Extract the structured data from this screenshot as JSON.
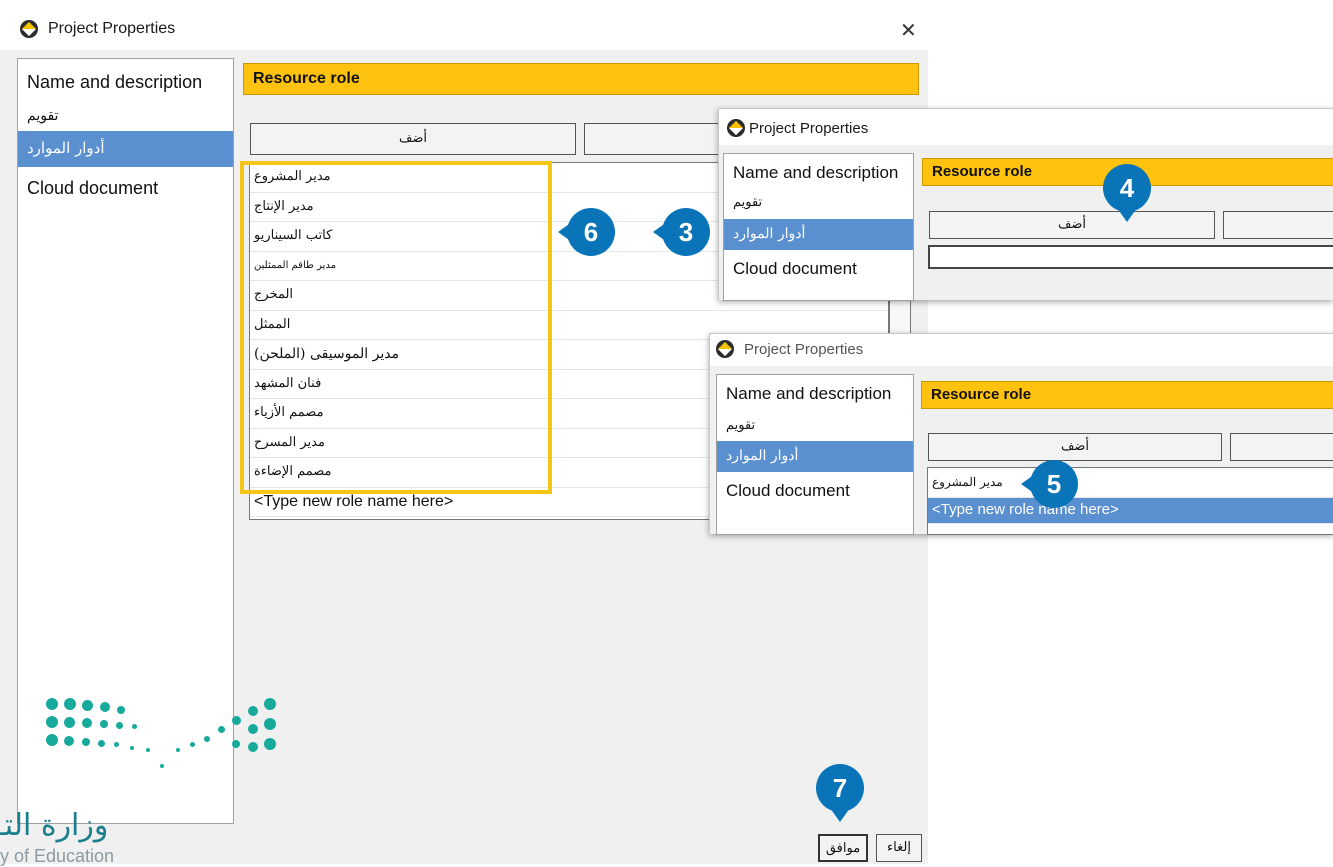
{
  "main_dialog": {
    "title": "Project Properties",
    "close_glyph": "✕",
    "nav": [
      "Name and description",
      "تقويم",
      "أدوار الموارد",
      "Cloud document"
    ],
    "selected_nav": "أدوار الموارد",
    "header": "Resource role",
    "add_button": "أضف",
    "roles": [
      "مدير المشروع",
      "مدير الإنتاج",
      "كاتب السيناريو",
      "مدير طاقم الممثلين",
      "المخرج",
      "الممثل",
      "مدير الموسيقى (الملحن)",
      "فنان المشهد",
      "مصمم الأزياء",
      "مدير المسرح",
      "مصمم الإضاءة"
    ],
    "new_role_placeholder": "<Type new role name here>",
    "ok_button": "موافق",
    "cancel_button": "إلغاء"
  },
  "inset_1": {
    "title": "Project Properties",
    "nav": [
      "Name and description",
      "تقويم",
      "أدوار الموارد",
      "Cloud document"
    ],
    "header": "Resource role",
    "add_button": "أضف"
  },
  "inset_2": {
    "title": "Project Properties",
    "nav": [
      "Name and description",
      "تقويم",
      "أدوار الموارد",
      "Cloud document"
    ],
    "header": "Resource role",
    "add_button": "أضف",
    "roles": [
      "مدير المشروع"
    ],
    "new_role_placeholder": "<Type new role name here>"
  },
  "step_markers": [
    "3",
    "4",
    "5",
    "6",
    "7"
  ],
  "logo": {
    "arabic_text": "وزارة التـ",
    "english_text": "ry of Education"
  },
  "colors": {
    "accent_header": "#ffc20e",
    "selection": "#5a8fd0",
    "highlight_box": "#f5c518",
    "marker": "#0a74b8",
    "logo_teal": "#17a99a"
  },
  "icons": [
    "project-app-icon",
    "close-icon"
  ]
}
